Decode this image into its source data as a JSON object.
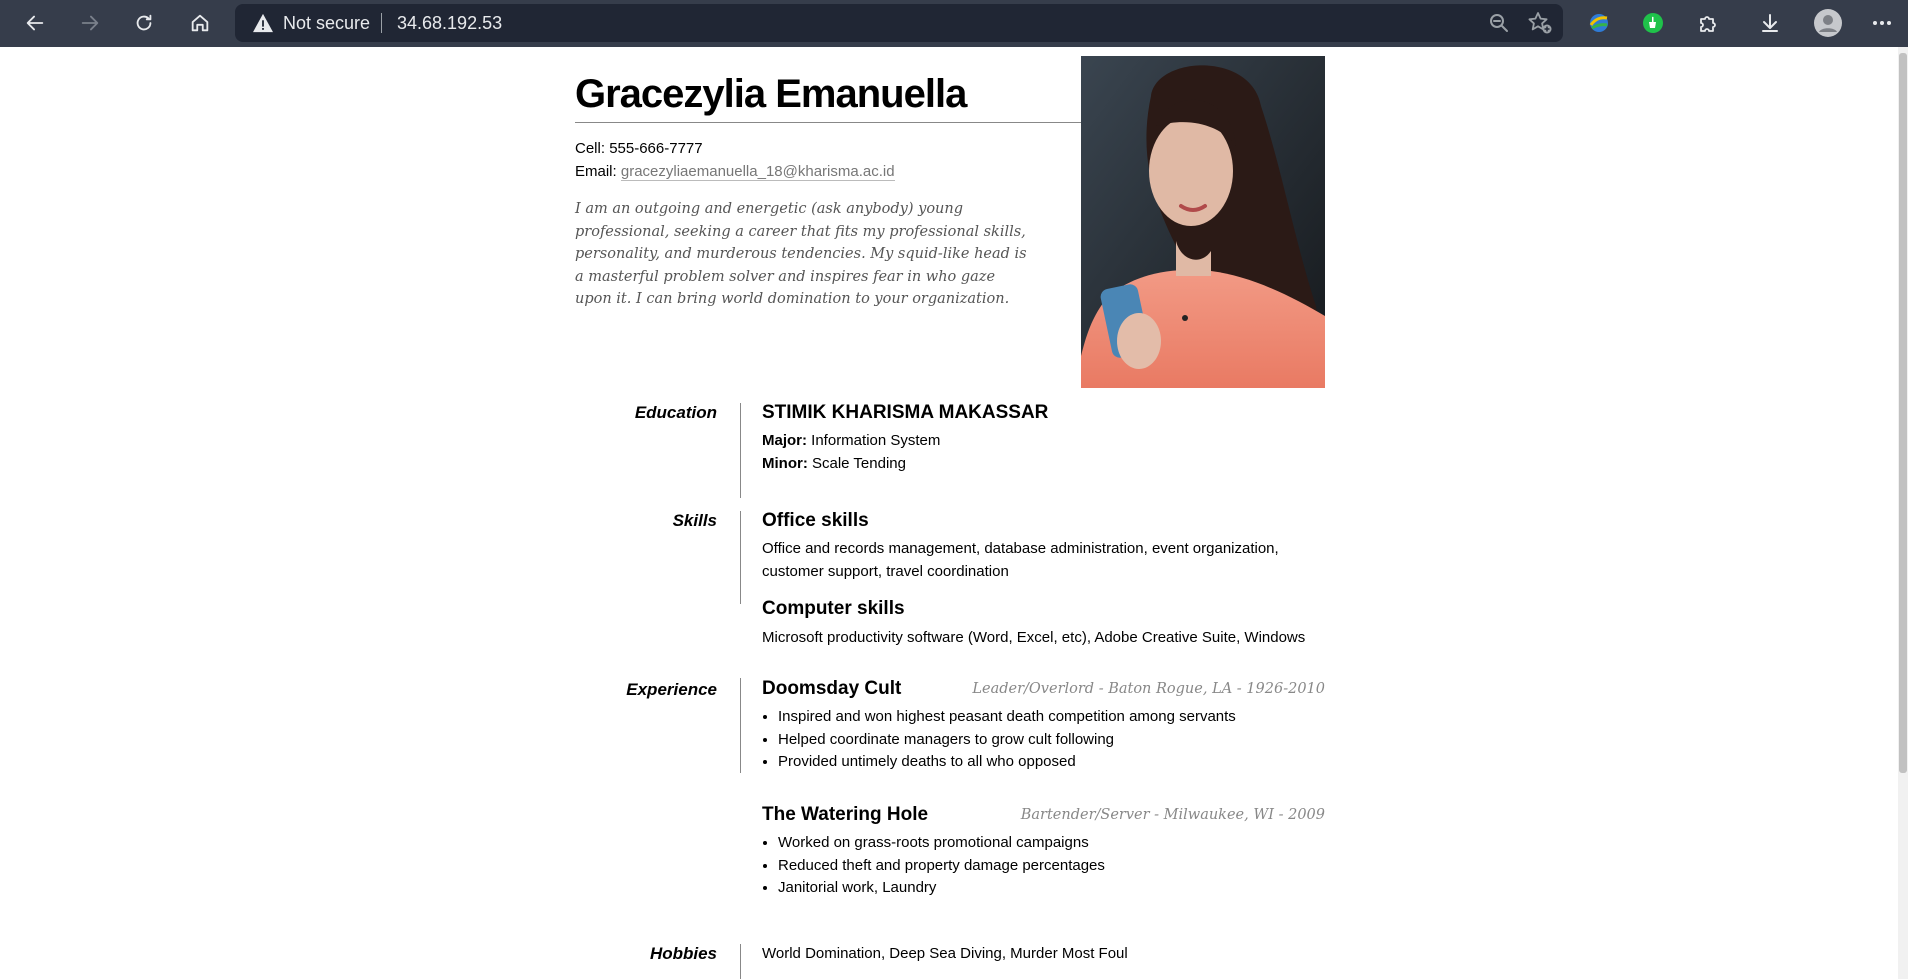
{
  "browser": {
    "security_label": "Not secure",
    "url": "34.68.192.53",
    "icons": [
      "back-icon",
      "forward-icon",
      "reload-icon",
      "home-icon",
      "warning-icon",
      "zoom-out-icon",
      "favorite-add-icon",
      "extension-globe-icon",
      "extension-green-icon",
      "extensions-puzzle-icon",
      "download-icon",
      "profile-avatar-icon",
      "more-menu-icon"
    ]
  },
  "resume": {
    "name": "Gracezylia Emanuella",
    "cell_label": "Cell:",
    "cell": "555-666-7777",
    "email_label": "Email:",
    "email": "gracezyliaemanuella_18@kharisma.ac.id",
    "summary": "I am an outgoing and energetic (ask anybody) young professional, seeking a career that fits my professional skills, personality, and murderous tendencies. My squid-like head is a masterful problem solver and inspires fear in who gaze upon it. I can bring world domination to your organization.",
    "education": {
      "label": "Education",
      "school": "STIMIK KHARISMA MAKASSAR",
      "major_label": "Major:",
      "major": "Information System",
      "minor_label": "Minor:",
      "minor": "Scale Tending"
    },
    "skills": {
      "label": "Skills",
      "office_title": "Office skills",
      "office_desc": "Office and records management, database administration, event organization, customer support, travel coordination",
      "computer_title": "Computer skills",
      "computer_desc": "Microsoft productivity software (Word, Excel, etc), Adobe Creative Suite, Windows"
    },
    "experience": {
      "label": "Experience",
      "jobs": [
        {
          "org": "Doomsday Cult",
          "meta": "Leader/Overlord - Baton Rogue, LA - 1926-2010",
          "bullets": [
            "Inspired and won highest peasant death competition among servants",
            "Helped coordinate managers to grow cult following",
            "Provided untimely deaths to all who opposed"
          ]
        },
        {
          "org": "The Watering Hole",
          "meta": "Bartender/Server - Milwaukee, WI - 2009",
          "bullets": [
            "Worked on grass-roots promotional campaigns",
            "Reduced theft and property damage percentages",
            "Janitorial work, Laundry"
          ]
        }
      ]
    },
    "hobbies": {
      "label": "Hobbies",
      "text": "World Domination, Deep Sea Diving, Murder Most Foul"
    }
  }
}
